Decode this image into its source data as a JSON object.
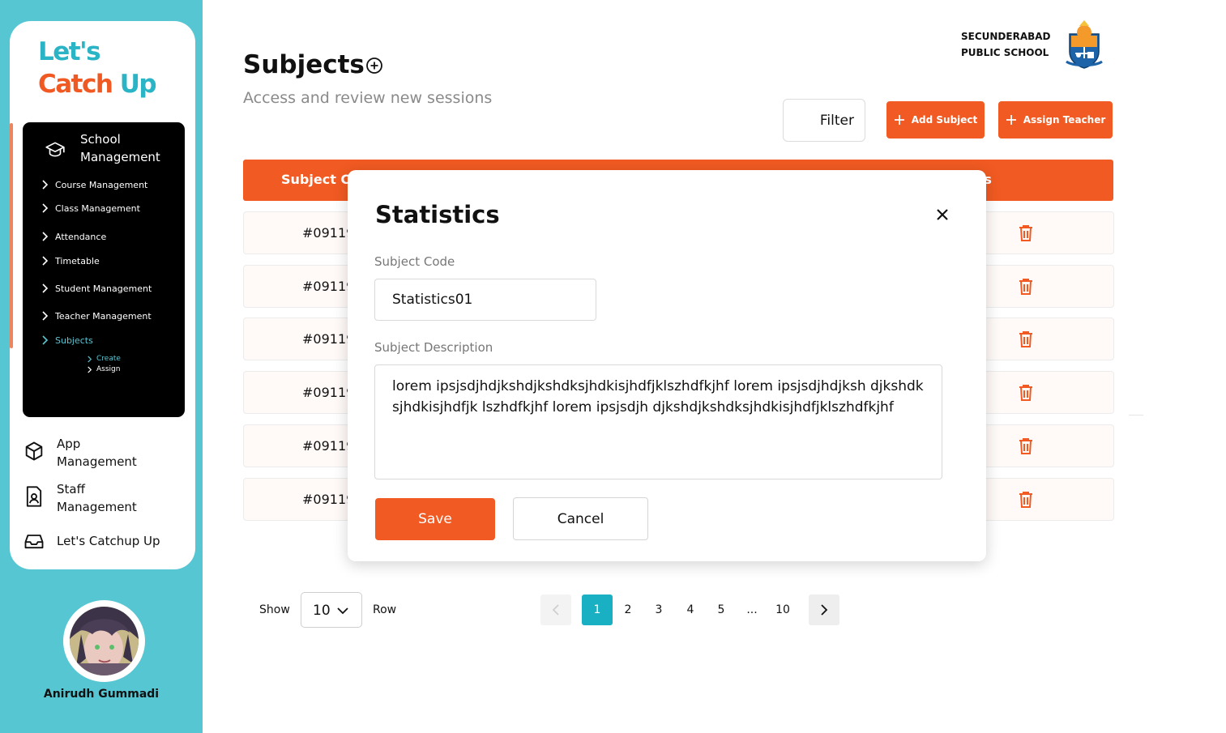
{
  "brand": {
    "line1": "Let's",
    "line2_main": "Catch ",
    "line2_accent": "Up"
  },
  "sidebar": {
    "school_management": {
      "label": "School Management",
      "items": [
        {
          "label": "Course Management"
        },
        {
          "label": "Class Management"
        },
        {
          "label": "Attendance"
        },
        {
          "label": "Timetable"
        },
        {
          "label": "Student Management"
        },
        {
          "label": "Teacher Management"
        },
        {
          "label": "Subjects",
          "active": true
        }
      ],
      "subjects_children": [
        {
          "label": "Create",
          "active": true
        },
        {
          "label": "Assign"
        }
      ]
    },
    "nav": [
      {
        "label": "App Management",
        "icon": "cube-icon"
      },
      {
        "label": "Staff Management",
        "icon": "id-badge-icon"
      },
      {
        "label": "Let's Catchup Up",
        "icon": "inbox-icon"
      }
    ],
    "user": {
      "name": "Anirudh Gummadi"
    }
  },
  "header": {
    "title": "Subjects",
    "subtitle": "Access and review new sessions",
    "school_line1": "SECUNDERABAD",
    "school_line2": "PUBLIC SCHOOL"
  },
  "toolbar": {
    "filter_label": "Filter",
    "add_subject_label": "Add Subject",
    "assign_teacher_label": "Assign Teacher"
  },
  "table": {
    "headers": {
      "code": "Subject Co",
      "actions": "ns"
    },
    "rows": [
      {
        "code": "#09119"
      },
      {
        "code": "#09119"
      },
      {
        "code": "#09119"
      },
      {
        "code": "#09119"
      },
      {
        "code": "#09119"
      },
      {
        "code": "#09119"
      }
    ]
  },
  "pagination": {
    "show_label": "Show",
    "rows_value": "10",
    "row_label": "Row",
    "pages": [
      "1",
      "2",
      "3",
      "4",
      "5",
      "...",
      "10"
    ],
    "current_page": "1"
  },
  "modal": {
    "title": "Statistics",
    "code_label": "Subject Code",
    "code_value": "Statistics01",
    "description_label": "Subject Description",
    "description_value": "lorem ipsjsdjhdjkshdjkshdksjhdkisjhdfjklszhdfkjhf lorem ipsjsdjhdjksh djkshdksjhdkisjhdfjk lszhdfkjhf lorem ipsjsdjh djkshdjkshdksjhdkisjhdfjklszhdfkjhf",
    "save_label": "Save",
    "cancel_label": "Cancel"
  },
  "colors": {
    "brand_orange": "#f15a22",
    "brand_teal": "#56c6d3",
    "active_page": "#1ab0c4"
  }
}
